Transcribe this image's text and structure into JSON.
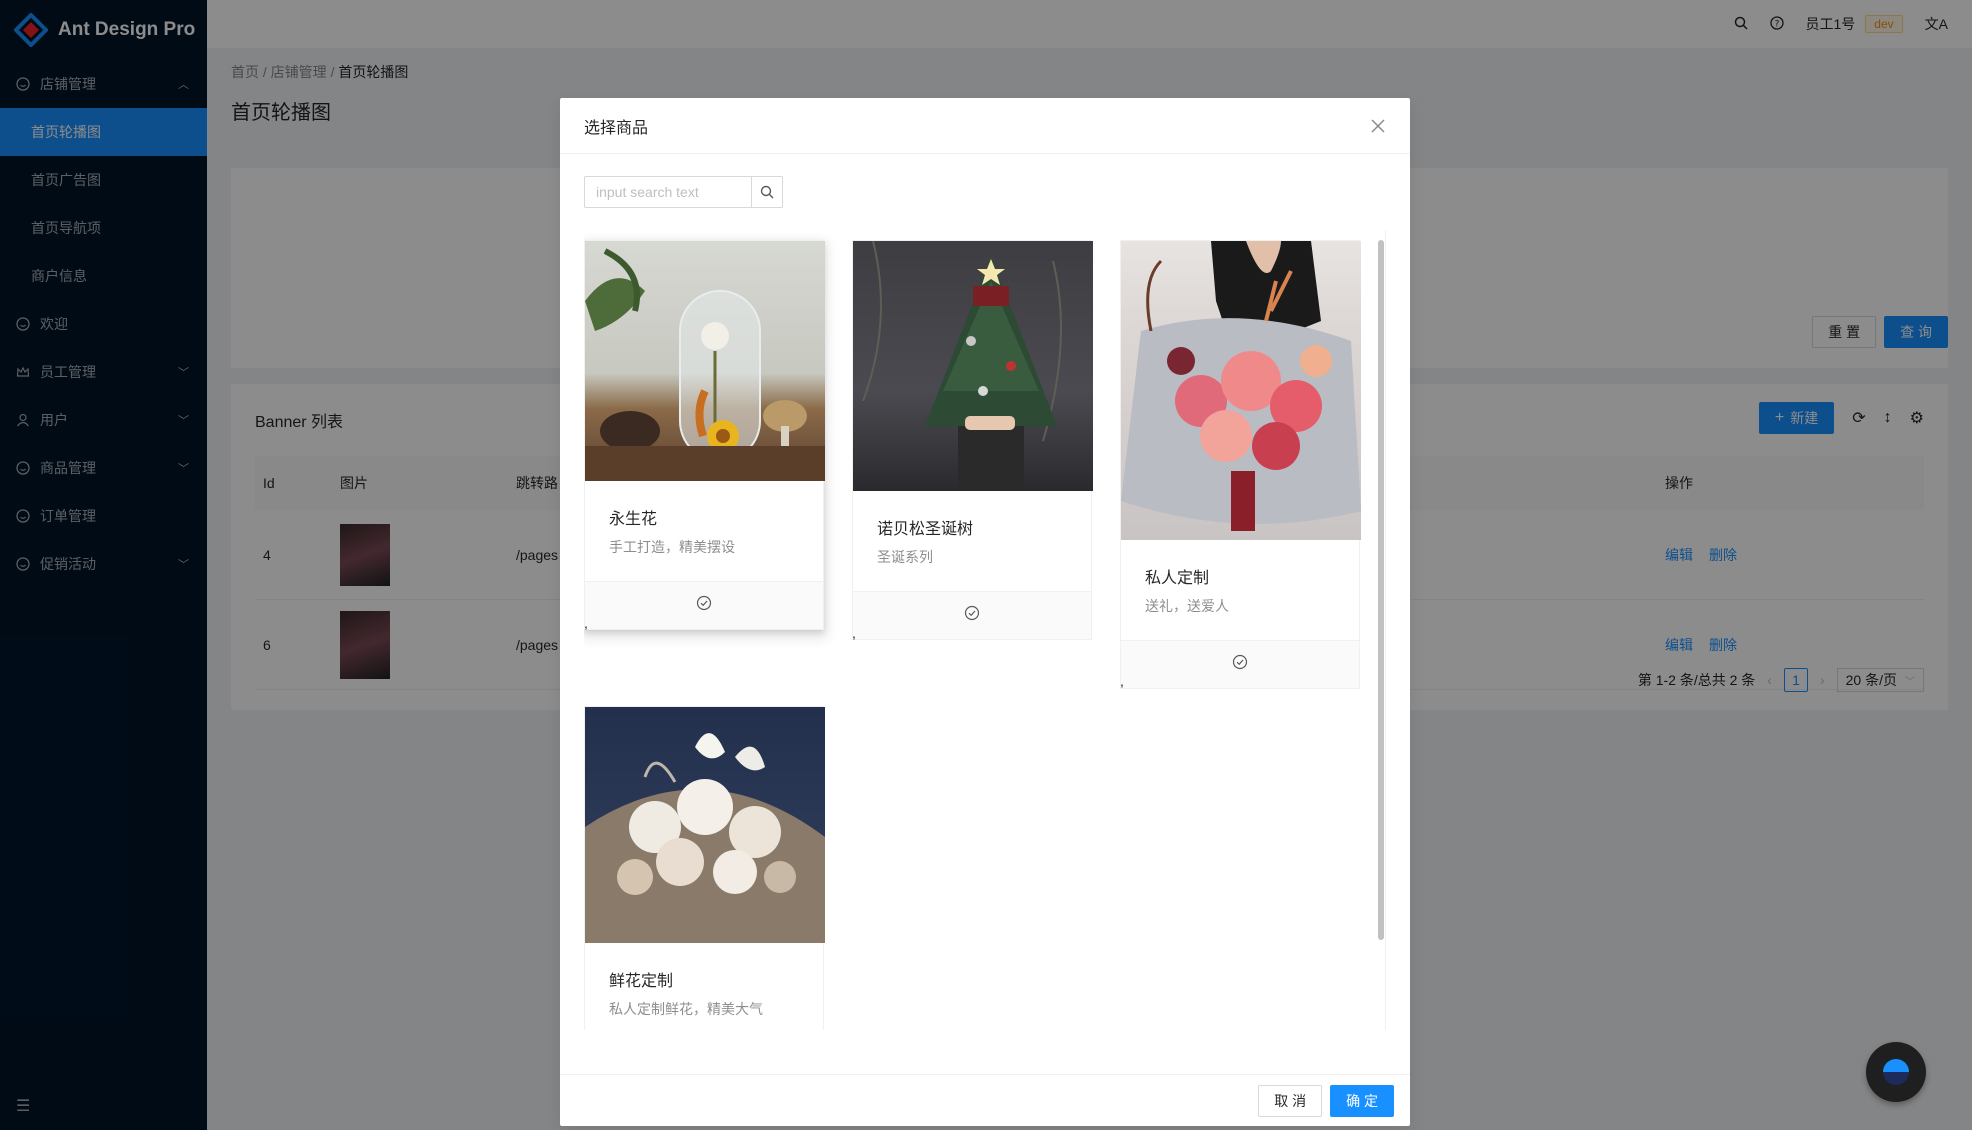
{
  "app": {
    "title": "Ant Design Pro"
  },
  "sidebar": {
    "groups": [
      {
        "label": "店铺管理",
        "icon": "smile-icon",
        "expanded": true
      },
      {
        "label": "欢迎",
        "icon": "smile-icon"
      },
      {
        "label": "员工管理",
        "icon": "crown-icon"
      },
      {
        "label": "用户",
        "icon": "user-icon"
      },
      {
        "label": "商品管理",
        "icon": "smile-icon"
      },
      {
        "label": "订单管理",
        "icon": "smile-icon"
      },
      {
        "label": "促销活动",
        "icon": "smile-icon"
      }
    ],
    "subitems": [
      {
        "label": "首页轮播图",
        "active": true
      },
      {
        "label": "首页广告图"
      },
      {
        "label": "首页导航项"
      },
      {
        "label": "商户信息"
      }
    ]
  },
  "header": {
    "user": "员工1号",
    "env": "dev"
  },
  "breadcrumb": {
    "home": "首页",
    "section": "店铺管理",
    "current": "首页轮播图"
  },
  "page": {
    "title": "首页轮播图"
  },
  "search_form": {
    "reset": "重 置",
    "query": "查 询"
  },
  "table": {
    "title": "Banner 列表",
    "new_button": "新建",
    "columns": {
      "id": "Id",
      "image": "图片",
      "path": "跳转路",
      "ops": "操作"
    },
    "rows": [
      {
        "id": "4",
        "path": "/pages",
        "edit": "编辑",
        "delete": "删除"
      },
      {
        "id": "6",
        "path": "/pages",
        "edit": "编辑",
        "delete": "删除"
      }
    ],
    "pagination": {
      "summary": "第 1-2 条/总共 2 条",
      "page": "1",
      "page_size": "20 条/页"
    }
  },
  "modal": {
    "title": "选择商品",
    "search_placeholder": "input search text",
    "products": [
      {
        "name": "永生花",
        "desc": "手工打造，精美摆设",
        "image": "glass-dome-flower"
      },
      {
        "name": "诺贝松圣诞树",
        "desc": "圣诞系列",
        "image": "christmas-tree"
      },
      {
        "name": "私人定制",
        "desc": "送礼，送爱人",
        "image": "pink-bouquet"
      },
      {
        "name": "鲜花定制",
        "desc": "私人定制鲜花，精美大气",
        "image": "white-roses-bouquet"
      }
    ],
    "separator": ",",
    "cancel": "取 消",
    "ok": "确 定"
  },
  "colors": {
    "primary": "#1890ff",
    "sidebar": "#001529",
    "mask": "rgba(0,0,0,0.45)"
  }
}
